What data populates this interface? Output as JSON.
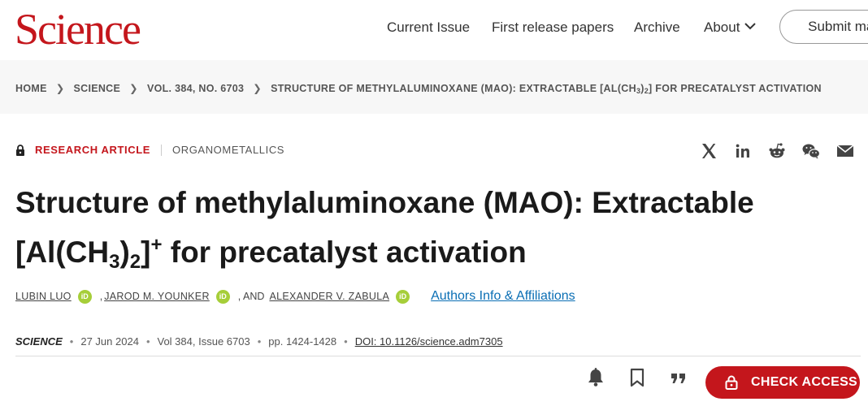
{
  "header": {
    "logo": "Science",
    "nav": [
      "Current Issue",
      "First release papers",
      "Archive",
      "About"
    ],
    "submit": "Submit man"
  },
  "breadcrumb": {
    "items": [
      "HOME",
      "SCIENCE",
      "VOL. 384, NO. 6703"
    ],
    "current_pre": "STRUCTURE OF METHYLALUMINOXANE (MAO): EXTRACTABLE [AL(CH",
    "current_sub1": "3",
    "current_mid": ")",
    "current_sub2": "2",
    "current_post": "] FOR PRECATALYST ACTIVATION"
  },
  "article": {
    "type": "RESEARCH ARTICLE",
    "subject": "ORGANOMETALLICS",
    "title_line1": "Structure of methylaluminoxane (MAO): Extractable",
    "title_l2_a": "[Al(CH",
    "title_l2_sub1": "3",
    "title_l2_b": ")",
    "title_l2_sub2": "2",
    "title_l2_c": "]",
    "title_l2_sup": "+",
    "title_l2_d": " for precatalyst activation"
  },
  "authors": {
    "list": [
      "LUBIN LUO",
      "JAROD M. YOUNKER",
      "ALEXANDER V. ZABULA"
    ],
    "sep1": ",",
    "sep2": ", AND",
    "orcid_label": "iD",
    "affiliations_link": "Authors Info & Affiliations"
  },
  "pubinfo": {
    "journal": "SCIENCE",
    "date": "27 Jun 2024",
    "volume": "Vol 384, Issue 6703",
    "pages": "pp. 1424-1428",
    "doi": "DOI: 10.1126/science.adm7305",
    "bullet": "•"
  },
  "actions": {
    "check_access": "CHECK ACCESS"
  },
  "icons": {
    "share": [
      "x-icon",
      "linkedin-icon",
      "reddit-icon",
      "wechat-icon",
      "email-icon"
    ],
    "actions": [
      "bell-icon",
      "bookmark-icon",
      "quote-icon"
    ]
  },
  "colors": {
    "brand_red": "#c4161c",
    "link_blue": "#0a6eb4",
    "orcid_green": "#a6ce39"
  }
}
